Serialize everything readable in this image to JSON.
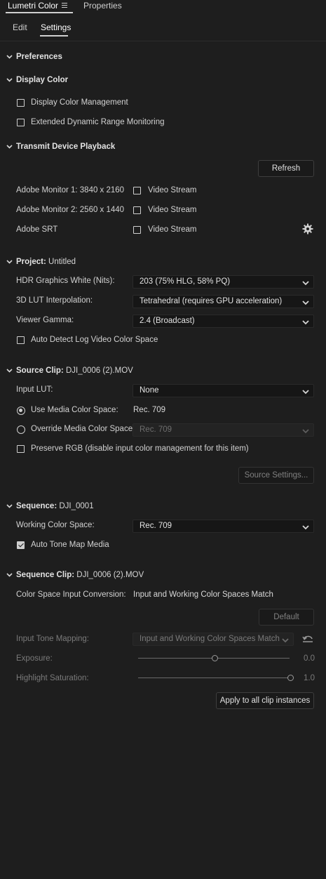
{
  "panel_tabs": {
    "lumetri": "Lumetri Color",
    "properties": "Properties"
  },
  "sub_tabs": {
    "edit": "Edit",
    "settings": "Settings"
  },
  "sections": {
    "preferences": "Preferences",
    "display_color": "Display Color",
    "transmit": "Transmit Device Playback",
    "project": "Project:",
    "project_name": "Untitled",
    "source_clip": "Source Clip:",
    "source_clip_name": "DJI_0006 (2).MOV",
    "sequence": "Sequence:",
    "sequence_name": "DJI_0001",
    "sequence_clip": "Sequence Clip:",
    "sequence_clip_name": "DJI_0006 (2).MOV"
  },
  "display_color": {
    "display_color_management": {
      "label": "Display Color Management",
      "checked": false
    },
    "edr_monitoring": {
      "label": "Extended Dynamic Range Monitoring",
      "checked": false
    }
  },
  "transmit": {
    "refresh": "Refresh",
    "monitors": [
      {
        "name": "Adobe Monitor 1: 3840 x 2160",
        "stream_label": "Video Stream",
        "checked": false
      },
      {
        "name": "Adobe Monitor 2: 2560 x 1440",
        "stream_label": "Video Stream",
        "checked": false
      },
      {
        "name": "Adobe SRT",
        "stream_label": "Video Stream",
        "checked": false
      }
    ],
    "settings_icon": "gear-icon"
  },
  "project": {
    "hdr_white_label": "HDR Graphics White (Nits):",
    "hdr_white_value": "203 (75% HLG, 58% PQ)",
    "lut_interp_label": "3D LUT Interpolation:",
    "lut_interp_value": "Tetrahedral (requires GPU acceleration)",
    "gamma_label": "Viewer Gamma:",
    "gamma_value": "2.4 (Broadcast)",
    "auto_detect_log": {
      "label": "Auto Detect Log Video Color Space",
      "checked": false
    }
  },
  "source_clip": {
    "input_lut_label": "Input LUT:",
    "input_lut_value": "None",
    "use_media_label": "Use Media Color Space:",
    "use_media_value": "Rec. 709",
    "use_media_selected": true,
    "override_label": "Override Media Color Space:",
    "override_value": "Rec. 709",
    "preserve_rgb": {
      "label": "Preserve RGB (disable input color management for this item)",
      "checked": false
    },
    "source_settings": "Source Settings..."
  },
  "sequence": {
    "working_label": "Working Color Space:",
    "working_value": "Rec. 709",
    "auto_tone_map": {
      "label": "Auto Tone Map Media",
      "checked": true
    }
  },
  "sequence_clip": {
    "input_conversion_label": "Color Space Input Conversion:",
    "input_conversion_value": "Input and Working Color Spaces Match",
    "default_btn": "Default",
    "tone_mapping_label": "Input Tone Mapping:",
    "tone_mapping_value": "Input and Working Color Spaces Match",
    "exposure_label": "Exposure:",
    "exposure_value": "0.0",
    "exposure_level": 0.5,
    "highlight_label": "Highlight Saturation:",
    "highlight_value": "1.0",
    "highlight_level": 1.0,
    "apply_all": "Apply to all clip instances"
  },
  "colors": {
    "background": "#1e1e1e",
    "text": "#d6d6d6",
    "dim_text": "#7a7a7a",
    "field_bg": "#161616"
  }
}
